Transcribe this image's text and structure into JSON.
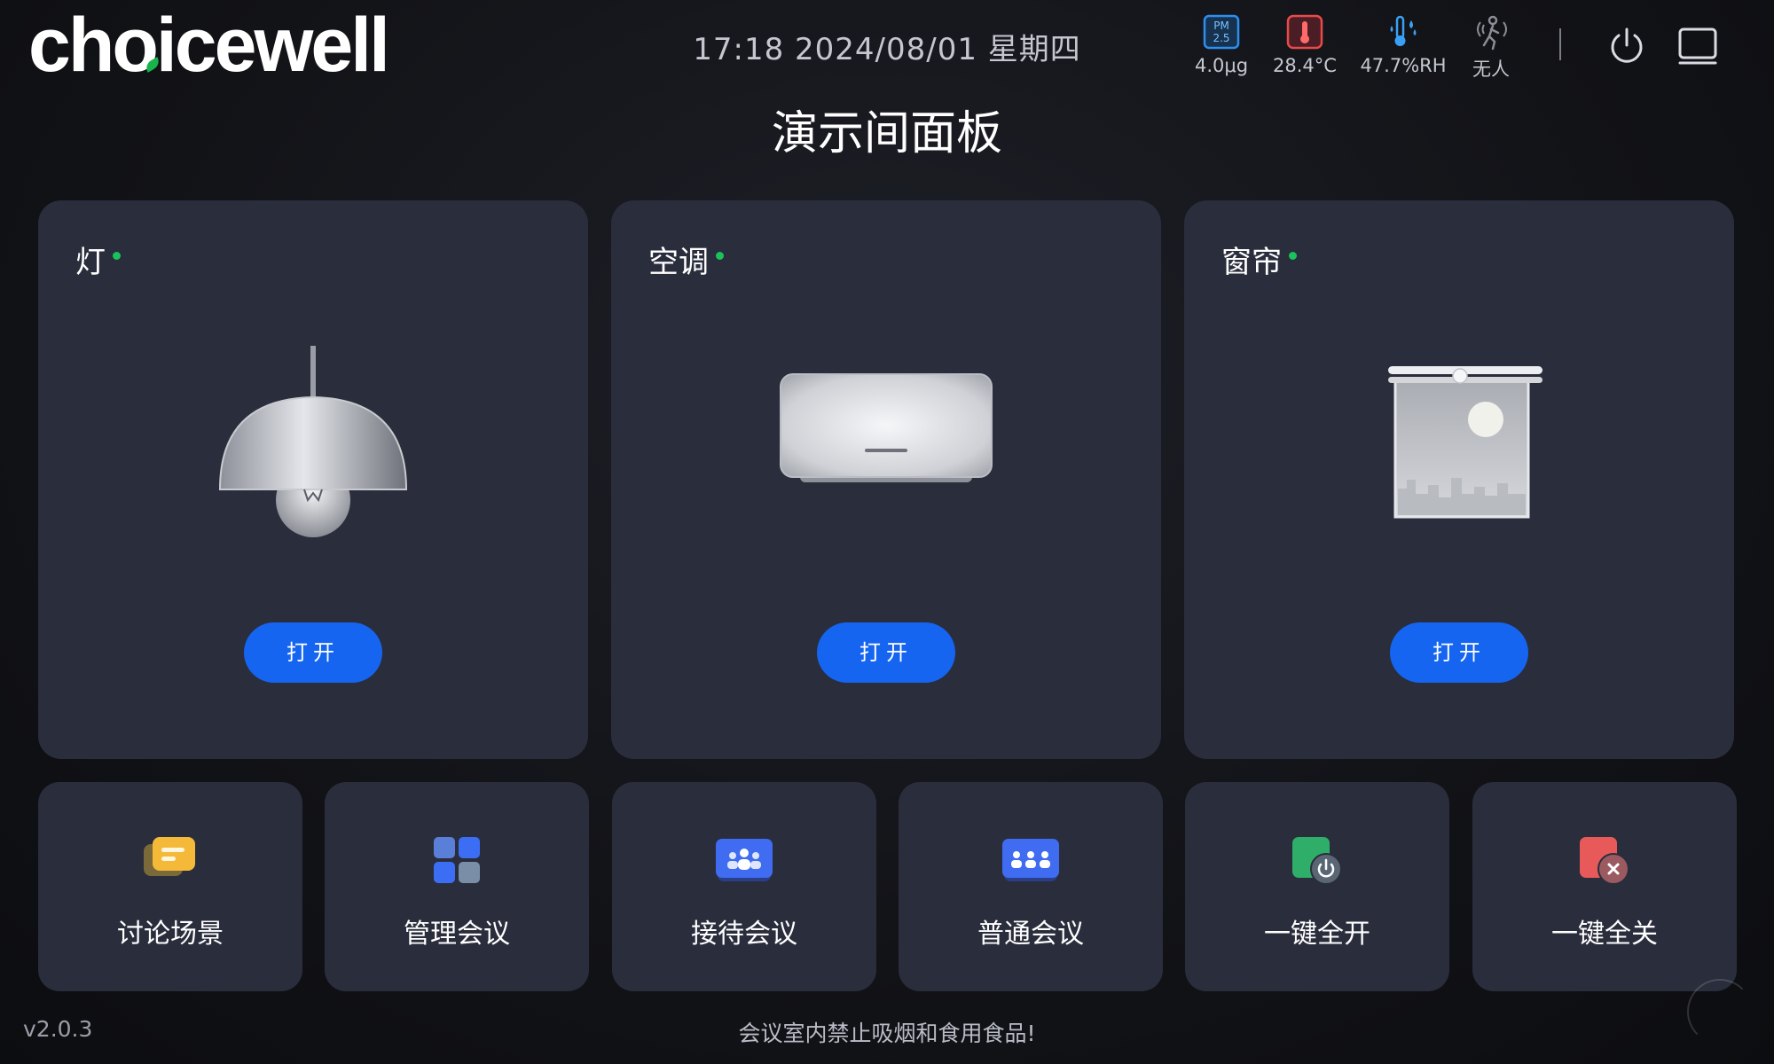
{
  "header": {
    "logo": "choicewell",
    "datetime": "17:18 2024/08/01 星期四",
    "title": "演示间面板",
    "sensors": [
      {
        "icon": "pm25-icon",
        "value": "4.0μg"
      },
      {
        "icon": "thermometer-icon",
        "value": "28.4°C"
      },
      {
        "icon": "humidity-icon",
        "value": "47.7%RH"
      },
      {
        "icon": "presence-icon",
        "value": "无人"
      }
    ],
    "pm_badge": [
      "PM",
      "2.5"
    ],
    "actions": [
      {
        "icon": "power-icon"
      },
      {
        "icon": "screen-icon"
      }
    ]
  },
  "devices": [
    {
      "name": "灯",
      "icon": "pendant-lamp-icon",
      "status": "online",
      "button": "打开"
    },
    {
      "name": "空调",
      "icon": "air-conditioner-icon",
      "status": "online",
      "button": "打开"
    },
    {
      "name": "窗帘",
      "icon": "curtain-icon",
      "status": "online",
      "button": "打开"
    }
  ],
  "scenes": [
    {
      "label": "讨论场景",
      "icon": "discussion-icon"
    },
    {
      "label": "管理会议",
      "icon": "management-icon"
    },
    {
      "label": "接待会议",
      "icon": "reception-icon"
    },
    {
      "label": "普通会议",
      "icon": "general-meeting-icon"
    },
    {
      "label": "一键全开",
      "icon": "all-on-icon"
    },
    {
      "label": "一键全关",
      "icon": "all-off-icon"
    }
  ],
  "footer": {
    "version": "v2.0.3",
    "notice": "会议室内禁止吸烟和食用食品!"
  },
  "colors": {
    "background": "#121317",
    "card": "#2a2d3c",
    "accent": "#1565f0",
    "status_online": "#19c25a",
    "pm_blue": "#2d8ff0",
    "temp_red": "#e84a4a",
    "humidity_blue": "#3aa0f5"
  }
}
